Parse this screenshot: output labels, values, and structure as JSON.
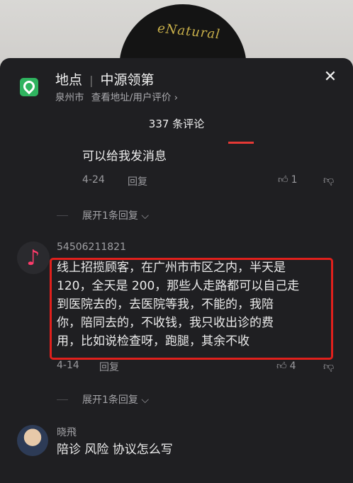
{
  "location": {
    "title_prefix": "地点",
    "separator": "|",
    "place_name": "中源领第",
    "city": "泉州市",
    "sub_link": "查看地址/用户评价",
    "chevron": "›"
  },
  "close_label": "✕",
  "comment_count": "337 条评论",
  "comments": [
    {
      "text": "可以给我发消息",
      "date": "4-24",
      "reply_label": "回复",
      "likes": "1",
      "expand_label": "展开1条回复"
    },
    {
      "username": "54506211821",
      "text_lines": [
        "线上招揽顾客，在广州市市区之内，半天是",
        "120，全天是 200，那些人走路都可以自己走",
        "到医院去的，去医院等我，不能的，我陪",
        "你，陪同去的，不收钱，我只收出诊的费",
        "用，比如说检查呀，跑腿，其余不收"
      ],
      "date": "4-14",
      "reply_label": "回复",
      "likes": "4",
      "expand_label": "展开1条回复"
    },
    {
      "username": "晓飛",
      "text": "陪诊 风险  协议怎么写"
    }
  ],
  "icons": {
    "location": "location-pin-icon",
    "like": "thumb-up-icon",
    "dislike": "thumb-down-icon",
    "expand": "chevron-down-icon",
    "close": "close-icon"
  },
  "colors": {
    "highlight_box": "#e0201c",
    "location_icon": "#2fb35f",
    "music_note": "#ff3b6b"
  }
}
